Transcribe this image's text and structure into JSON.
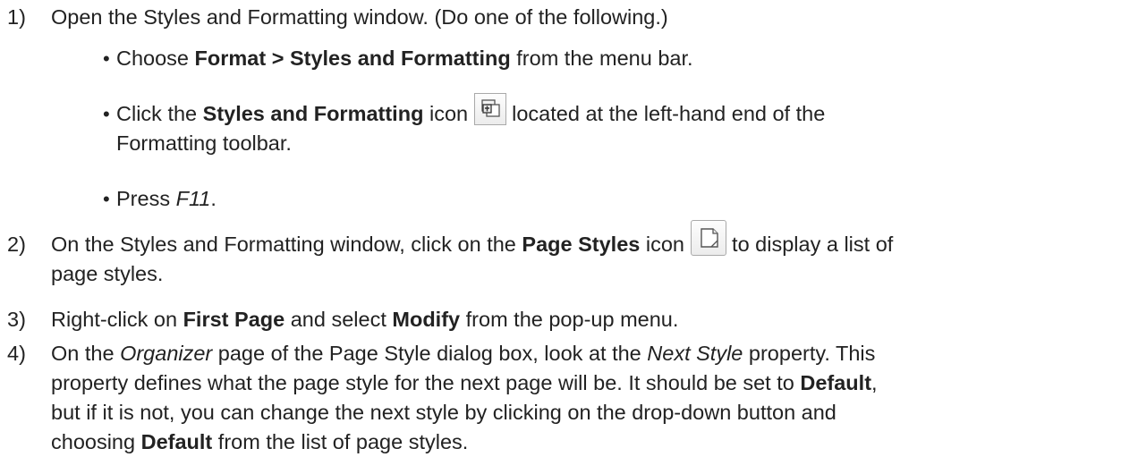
{
  "steps": [
    {
      "num": "1)",
      "text": "Open the Styles and Formatting window. (Do one of the following.)",
      "bullets": [
        {
          "bullet": "•",
          "pre": "Choose ",
          "bold": "Format > Styles and Formatting",
          "post": " from the menu bar."
        },
        {
          "bullet": "•",
          "pre": "Click the ",
          "bold": "Styles and Formatting",
          "mid": " icon",
          "post_line1": "located at the left-hand end of the",
          "line2": "Formatting toolbar."
        },
        {
          "bullet": "•",
          "pre": "Press ",
          "italic": "F11",
          "post": "."
        }
      ]
    },
    {
      "num": "2)",
      "pre": "On the Styles and Formatting window, click on the ",
      "bold": "Page Styles",
      "mid": " icon",
      "post_line1": "to display a list of",
      "line2": "page styles."
    },
    {
      "num": "3)",
      "pre": "Right-click on ",
      "bold1": "First Page",
      "mid": " and select ",
      "bold2": "Modify",
      "post": " from the pop-up menu."
    },
    {
      "num": "4)",
      "l1_pre": "On the ",
      "l1_i1": "Organizer",
      "l1_mid": " page of the Page Style dialog box, look at the ",
      "l1_i2": "Next Style",
      "l1_post": " property. This",
      "l2_pre": "property defines what the page style for the next page will be. It should be set to ",
      "l2_bold": "Default",
      "l2_post": ",",
      "l3": "but if it is not, you can change the next style by clicking on the drop-down button and",
      "l4_pre": "choosing ",
      "l4_bold": "Default",
      "l4_post": " from the list of page styles."
    }
  ],
  "icons": {
    "styles_formatting": "styles-and-formatting-icon",
    "page_styles": "page-styles-icon"
  }
}
